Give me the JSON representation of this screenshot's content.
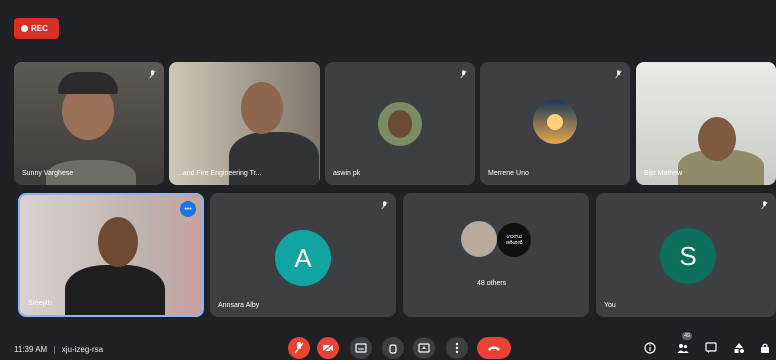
{
  "rec": {
    "label": "REC"
  },
  "tiles_top": [
    {
      "name": "Sunny Varghese"
    },
    {
      "name": "...and Fire Engineering Tr..."
    },
    {
      "name": "aswin pk"
    },
    {
      "name": "Merrene Uno"
    },
    {
      "name": "Bijo Mathew"
    }
  ],
  "tiles_bottom": [
    {
      "name": "Sreejith"
    },
    {
      "name": "Annsara Alby",
      "initial": "A",
      "color": "#12a4a0"
    },
    {
      "name": "48 others",
      "bubble_text": "ഗാന്ധ ദർശൻ"
    },
    {
      "name": "You",
      "initial": "S",
      "color": "#0b6f5b"
    }
  ],
  "footer": {
    "time": "11:39 AM",
    "separator": "|",
    "meeting_code": "xju-izeg-rsa",
    "participants_badge": "49"
  },
  "colors": {
    "end_call": "#ea4335",
    "active_speaker": "#8ab4f8",
    "rec": "#d93025"
  }
}
